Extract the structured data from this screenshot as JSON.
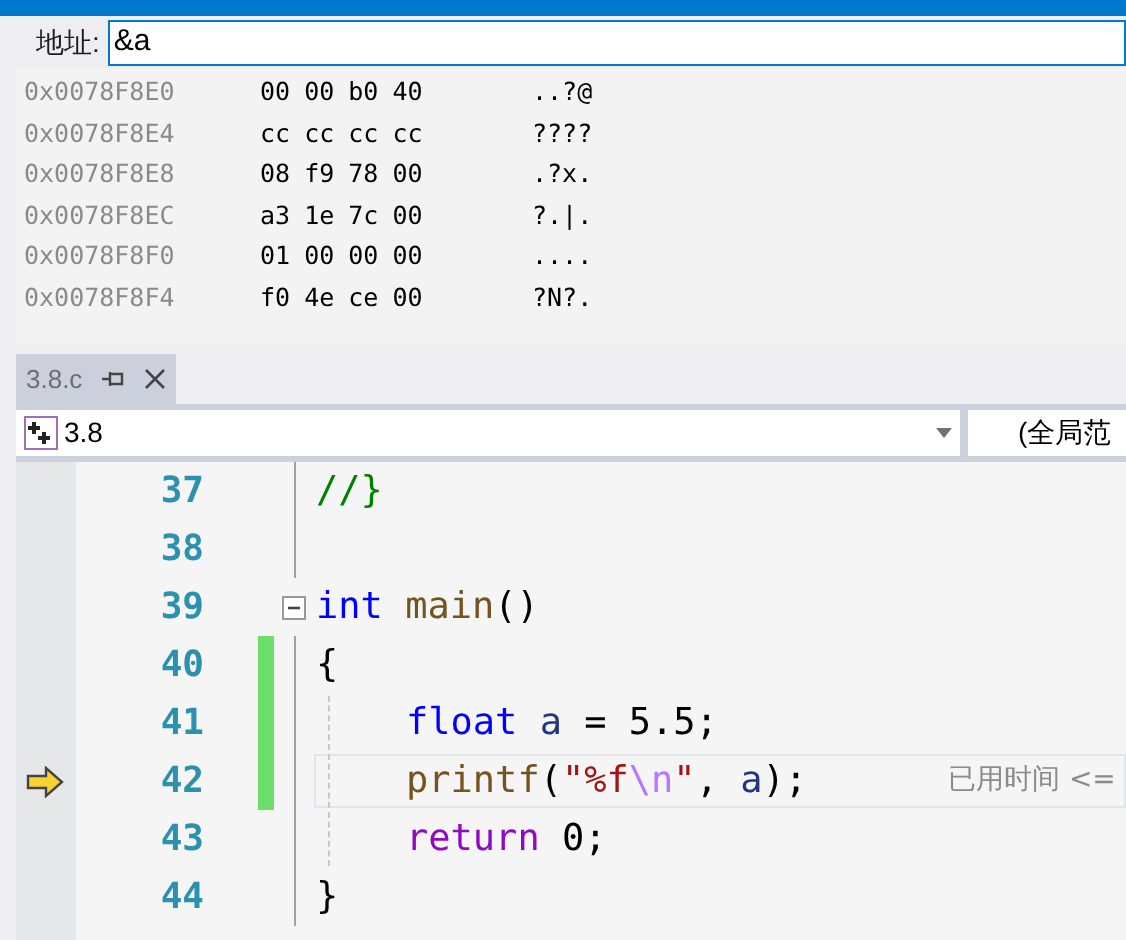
{
  "memory": {
    "address_label": "地址:",
    "address_value": "&a",
    "rows": [
      {
        "address": "0x0078F8E0",
        "bytes": [
          "00",
          "00",
          "b0",
          "40"
        ],
        "ascii": "..?@"
      },
      {
        "address": "0x0078F8E4",
        "bytes": [
          "cc",
          "cc",
          "cc",
          "cc"
        ],
        "ascii": "????"
      },
      {
        "address": "0x0078F8E8",
        "bytes": [
          "08",
          "f9",
          "78",
          "00"
        ],
        "ascii": ".?x."
      },
      {
        "address": "0x0078F8EC",
        "bytes": [
          "a3",
          "1e",
          "7c",
          "00"
        ],
        "ascii": "?.|."
      },
      {
        "address": "0x0078F8F0",
        "bytes": [
          "01",
          "00",
          "00",
          "00"
        ],
        "ascii": "...."
      },
      {
        "address": "0x0078F8F4",
        "bytes": [
          "f0",
          "4e",
          "ce",
          "00"
        ],
        "ascii": "?N?."
      }
    ]
  },
  "tabs": [
    {
      "label": "3.8.c",
      "selected": true
    }
  ],
  "navigation": {
    "scope": "3.8",
    "member": "(全局范"
  },
  "editor": {
    "lines": [
      {
        "number": "37",
        "changed": false,
        "current": false,
        "fold": false,
        "indented": false,
        "tokens": [
          {
            "text": "//}",
            "kind": "comment"
          }
        ]
      },
      {
        "number": "38",
        "changed": false,
        "current": false,
        "fold": false,
        "indented": false
      },
      {
        "number": "39",
        "changed": false,
        "current": false,
        "fold": true,
        "indented": false,
        "tokens": [
          {
            "text": "int ",
            "kind": "keyword"
          },
          {
            "text": "main",
            "kind": "function"
          },
          {
            "text": "()",
            "kind": "plain"
          }
        ]
      },
      {
        "number": "40",
        "changed": true,
        "current": false,
        "fold": false,
        "indented": false,
        "tokens": [
          {
            "text": "{",
            "kind": "plain"
          }
        ]
      },
      {
        "number": "41",
        "changed": true,
        "current": false,
        "fold": false,
        "indented": true,
        "tokens": [
          {
            "text": "float ",
            "kind": "keyword"
          },
          {
            "text": "a",
            "kind": "variable"
          },
          {
            "text": " = 5.5;",
            "kind": "plain"
          }
        ]
      },
      {
        "number": "42",
        "changed": true,
        "current": true,
        "fold": false,
        "indented": true,
        "hint": "已用时间 <=",
        "tokens": [
          {
            "text": "printf",
            "kind": "function"
          },
          {
            "text": "(",
            "kind": "plain"
          },
          {
            "text": "\"%f",
            "kind": "string"
          },
          {
            "text": "\\n",
            "kind": "escape"
          },
          {
            "text": "\"",
            "kind": "string"
          },
          {
            "text": ", ",
            "kind": "plain"
          },
          {
            "text": "a",
            "kind": "variable"
          },
          {
            "text": ");",
            "kind": "plain"
          }
        ]
      },
      {
        "number": "43",
        "changed": false,
        "current": false,
        "fold": false,
        "indented": true,
        "tokens": [
          {
            "text": "return",
            "kind": "control"
          },
          {
            "text": " 0;",
            "kind": "plain"
          }
        ]
      },
      {
        "number": "44",
        "changed": false,
        "current": false,
        "fold": false,
        "indented": false,
        "tokens": [
          {
            "text": "}",
            "kind": "plain"
          }
        ]
      }
    ]
  }
}
